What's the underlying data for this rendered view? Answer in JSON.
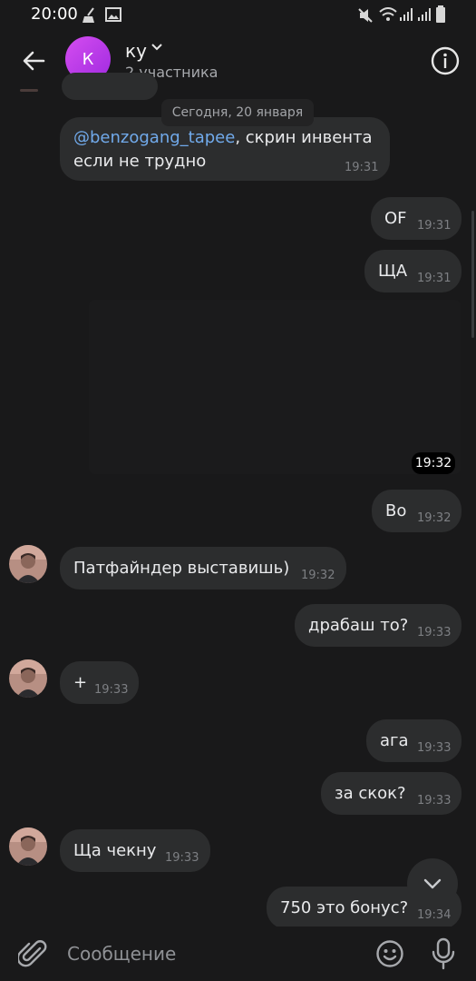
{
  "status_bar": {
    "time": "20:00"
  },
  "header": {
    "avatar_letter": "К",
    "title": "ку",
    "subtitle": "2 участника"
  },
  "date_separator": "Сегодня, 20 января",
  "messages": [
    {
      "mention": "@benzogang_tapee",
      "line1_rest": ", скрин  инвента",
      "line2": "если не трудно",
      "time": "19:31"
    },
    {
      "text": "OF",
      "time": "19:31"
    },
    {
      "text": "ЩА",
      "time": "19:31"
    },
    {
      "media_time": "19:32"
    },
    {
      "text": "Во",
      "time": "19:32"
    },
    {
      "text": "Патфайндер выставишь)",
      "time": "19:32"
    },
    {
      "text": "драбаш то?",
      "time": "19:33"
    },
    {
      "text": "+",
      "time": "19:33"
    },
    {
      "text": "ага",
      "time": "19:33"
    },
    {
      "text": "за скок?",
      "time": "19:33"
    },
    {
      "text": "Ща чекну",
      "time": "19:33"
    },
    {
      "text": "750 это бонус?",
      "time": "19:34"
    }
  ],
  "composer": {
    "placeholder": "Сообщение"
  },
  "icons": {
    "back": "arrow-left-icon",
    "info": "info-icon",
    "attach": "paperclip-icon",
    "emoji": "smile-icon",
    "mic": "microphone-icon",
    "scroll_down": "chevron-down-icon"
  },
  "colors": {
    "background": "#19191a",
    "bubble": "#2c2d2e",
    "mention": "#71aaeb",
    "avatar": "#b43de6"
  }
}
